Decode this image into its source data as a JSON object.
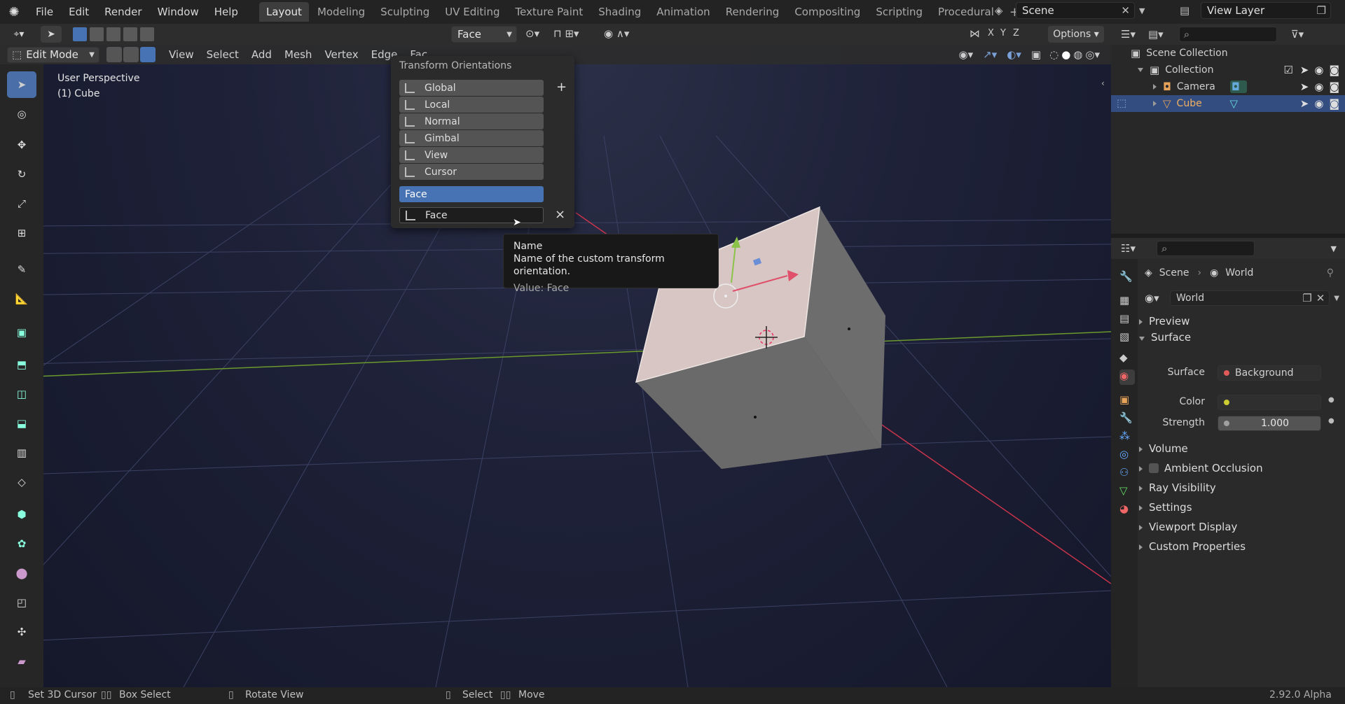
{
  "topbar": {
    "menus": [
      "File",
      "Edit",
      "Render",
      "Window",
      "Help"
    ],
    "workspaces": [
      "Layout",
      "Modeling",
      "Sculpting",
      "UV Editing",
      "Texture Paint",
      "Shading",
      "Animation",
      "Rendering",
      "Compositing",
      "Scripting",
      "Procedural"
    ],
    "add_tab": "+",
    "scene": "Scene",
    "view_layer": "View Layer"
  },
  "tool_header": {
    "orientation": "Face",
    "options": "Options",
    "axes": [
      "X",
      "Y",
      "Z"
    ]
  },
  "viewport_header": {
    "mode": "Edit Mode",
    "menus": [
      "View",
      "Select",
      "Add",
      "Mesh",
      "Vertex",
      "Edge",
      "Fac"
    ]
  },
  "viewport": {
    "perspective": "User Perspective",
    "object": "(1) Cube"
  },
  "popup": {
    "title": "Transform Orientations",
    "items": [
      "Global",
      "Local",
      "Normal",
      "Gimbal",
      "View",
      "Cursor"
    ],
    "add": "+",
    "custom_selected": "Face",
    "name_field": "Face",
    "close": "×"
  },
  "tooltip": {
    "title": "Name",
    "description": "Name of the custom transform orientation.",
    "value": "Value: Face"
  },
  "outliner": {
    "root": "Scene Collection",
    "collection": "Collection",
    "items": [
      "Camera",
      "Cube"
    ]
  },
  "properties": {
    "breadcrumb_scene": "Scene",
    "breadcrumb_world": "World",
    "world_name": "World",
    "panels_top": [
      "Preview"
    ],
    "surface_panel": "Surface",
    "surface_label": "Surface",
    "surface_value": "Background",
    "color_label": "Color",
    "strength_label": "Strength",
    "strength_value": "1.000",
    "panels_bottom": [
      "Volume",
      "Ambient Occlusion",
      "Ray Visibility",
      "Settings",
      "Viewport Display",
      "Custom Properties"
    ]
  },
  "status": {
    "items": [
      "Set 3D Cursor",
      "Box Select",
      "Rotate View",
      "Select",
      "Move"
    ],
    "version": "2.92.0 Alpha"
  },
  "colors": {
    "accent": "#4772b3",
    "cube_face_selected": "#d7c6c3",
    "cube_side": "#6c6c6c",
    "x_axis": "#c9344b",
    "y_axis": "#6b9a2c"
  }
}
